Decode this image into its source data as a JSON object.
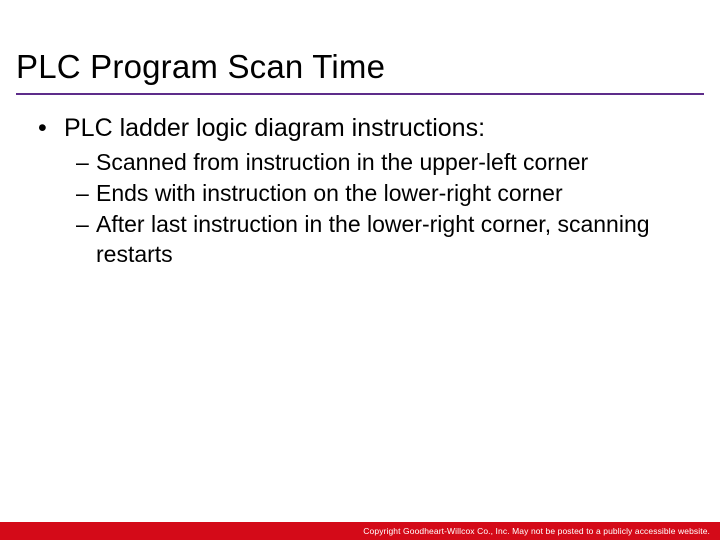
{
  "title": "PLC Program Scan Time",
  "bullets": {
    "lvl1": "PLC ladder logic diagram instructions:",
    "sub": [
      "Scanned from instruction in the upper-left corner",
      "Ends with instruction on the lower-right corner",
      "After last instruction in the lower-right corner, scanning restarts"
    ]
  },
  "footer": "Copyright Goodheart-Willcox Co., Inc.  May not be posted to a publicly accessible website."
}
